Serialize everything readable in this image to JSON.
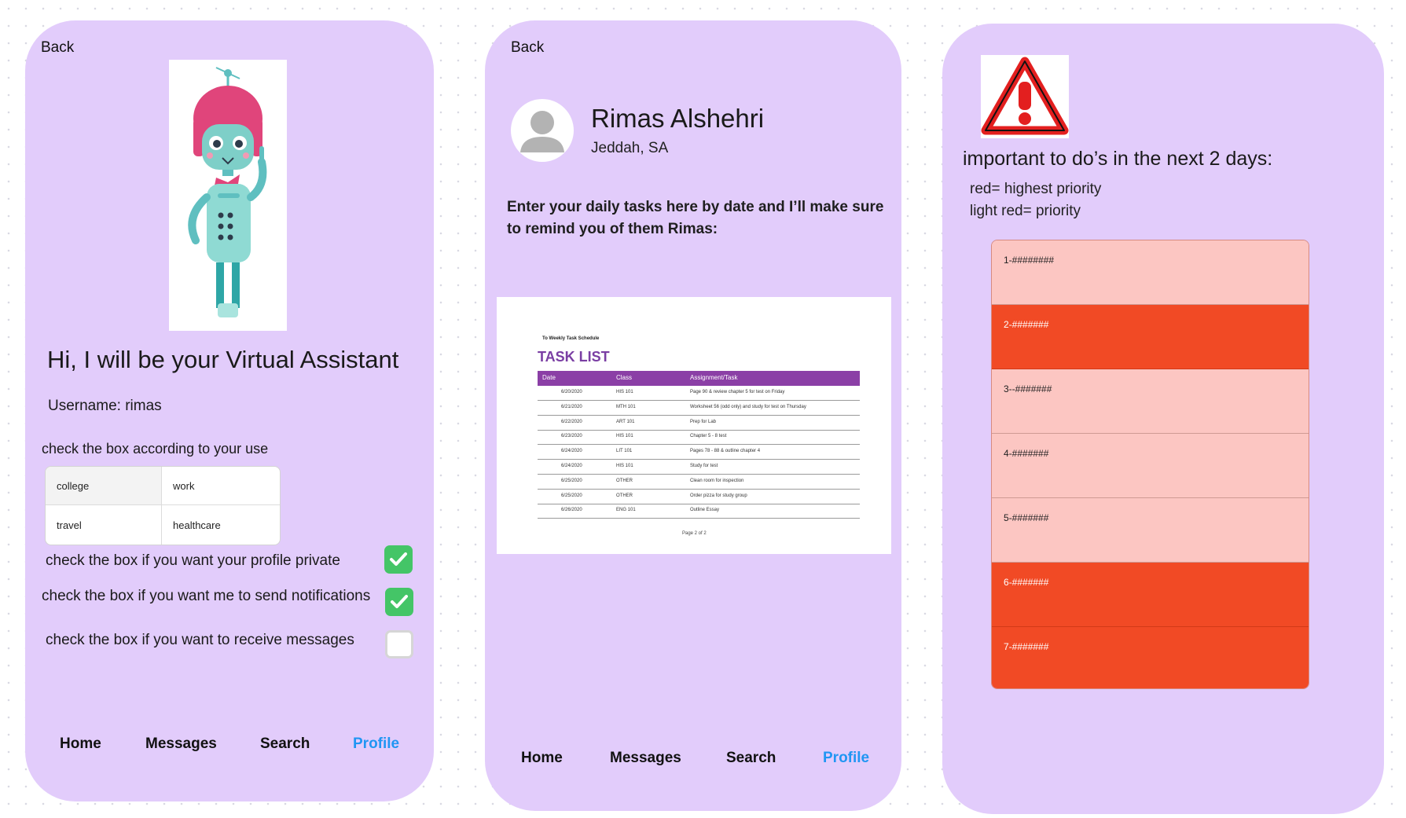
{
  "screen1": {
    "back_label": "Back",
    "greeting": "Hi, I will be your Virtual Assistant",
    "username": "Username: rimas",
    "use_instruction": "check the box according to your use",
    "use_options": [
      "college",
      "work",
      "travel",
      "healthcare"
    ],
    "options": [
      {
        "label": "check the box if you want your profile private",
        "checked": true
      },
      {
        "label": "check the box if you want me to send notifications",
        "checked": true
      },
      {
        "label": "check the box if you want to receive messages",
        "checked": false
      }
    ],
    "nav": [
      "Home",
      "Messages",
      "Search",
      "Profile"
    ],
    "active_nav": "Profile"
  },
  "screen2": {
    "back_label": "Back",
    "profile_name": "Rimas Alshehri",
    "profile_location": "Jeddah, SA",
    "description": "Enter your daily tasks here by date and I’ll make sure to remind you of them Rimas:",
    "task_sheet": {
      "subtitle": "To Weekly Task Schedule",
      "title": "TASK LIST",
      "headers": [
        "Date",
        "Class",
        "Assignment/Task"
      ],
      "rows": [
        [
          "6/20/2020",
          "HIS 101",
          "Page 90 & review chapter 5 for test on Friday"
        ],
        [
          "6/21/2020",
          "MTH 101",
          "Worksheet 56 (odd only) and study for test on Thursday"
        ],
        [
          "6/22/2020",
          "ART 101",
          "Prep for Lab"
        ],
        [
          "6/23/2020",
          "HIS 101",
          "Chapter 5 - 8 test"
        ],
        [
          "6/24/2020",
          "LIT 101",
          "Pages 78 - 88 & outline chapter 4"
        ],
        [
          "6/24/2020",
          "HIS 101",
          "Study for test"
        ],
        [
          "6/25/2020",
          "OTHER",
          "Clean room for inspection"
        ],
        [
          "6/25/2020",
          "OTHER",
          "Order pizza for study group"
        ],
        [
          "6/26/2020",
          "ENG 101",
          "Outline Essay"
        ]
      ],
      "footer": "Page 2 of 2"
    },
    "nav": [
      "Home",
      "Messages",
      "Search",
      "Profile"
    ],
    "active_nav": "Profile"
  },
  "screen3": {
    "heading": "important to do’s in the next 2 days:",
    "legend": [
      "red= highest priority",
      "light red= priority"
    ],
    "priority_items": [
      {
        "label": "1-########",
        "level": "light"
      },
      {
        "label": "2-#######",
        "level": "high"
      },
      {
        "label": "3--#######",
        "level": "light"
      },
      {
        "label": "4-#######",
        "level": "light"
      },
      {
        "label": "5-#######",
        "level": "light"
      },
      {
        "label": "6-#######",
        "level": "high"
      },
      {
        "label": "7-#######",
        "level": "high"
      }
    ]
  },
  "colors": {
    "phone_bg": "#e2ccfb",
    "accent_blue": "#2196f3",
    "check_green": "#44c567",
    "high_priority": "#f14a25",
    "priority": "#fcc6c2",
    "task_header_purple": "#8b3fa6"
  }
}
